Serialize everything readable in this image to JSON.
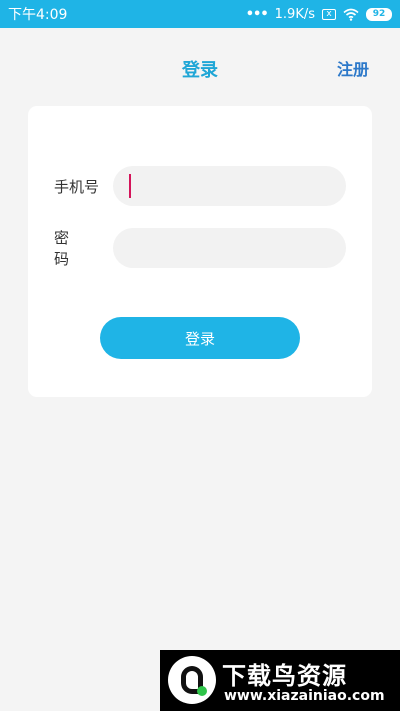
{
  "status_bar": {
    "time": "下午4:09",
    "net_speed": "1.9K/s",
    "battery": "92",
    "dots": "•••",
    "sim_mark": "x"
  },
  "header": {
    "title": "登录",
    "register_label": "注册"
  },
  "form": {
    "phone_label": "手机号",
    "phone_value": "",
    "password_label": "密码",
    "password_value": "",
    "login_label": "登录"
  },
  "watermark": {
    "title": "下载鸟资源",
    "url": "www.xiazainiao.com"
  },
  "colors": {
    "accent": "#1fb4e6",
    "title": "#1fa6d6",
    "register": "#2c78c9",
    "caret": "#d4145a",
    "background": "#f4f4f4"
  }
}
